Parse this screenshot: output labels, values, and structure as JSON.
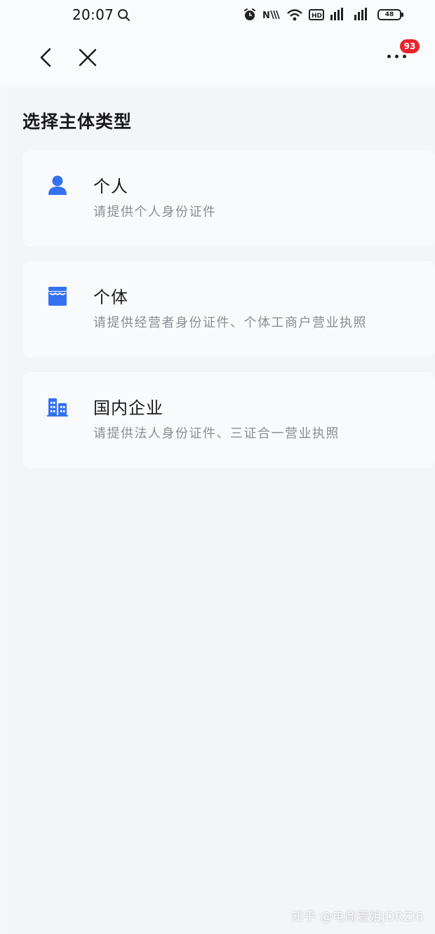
{
  "status_bar": {
    "time": "20:07",
    "icons": [
      "search-notification-icon",
      "alarm-icon",
      "nfc-icon",
      "wifi-icon",
      "hd-icon",
      "signal-icon-1",
      "signal-icon-2",
      "battery-icon"
    ],
    "battery": "48"
  },
  "nav": {
    "back_icon": "chevron-left-icon",
    "close_icon": "close-icon",
    "more_icon": "more-dots-icon",
    "badge_count": "93",
    "badge_color": "#e8242b"
  },
  "page": {
    "title": "选择主体类型"
  },
  "options": [
    {
      "icon": "person-icon",
      "title": "个人",
      "desc": "请提供个人身份证件"
    },
    {
      "icon": "store-icon",
      "title": "个体",
      "desc": "请提供经营者身份证件、个体工商户营业执照"
    },
    {
      "icon": "building-icon",
      "title": "国内企业",
      "desc": "请提供法人身份证件、三证合一营业执照"
    }
  ],
  "accent_color": "#3471f0",
  "watermark": "知乎 @电商壹姐JDRZi6"
}
